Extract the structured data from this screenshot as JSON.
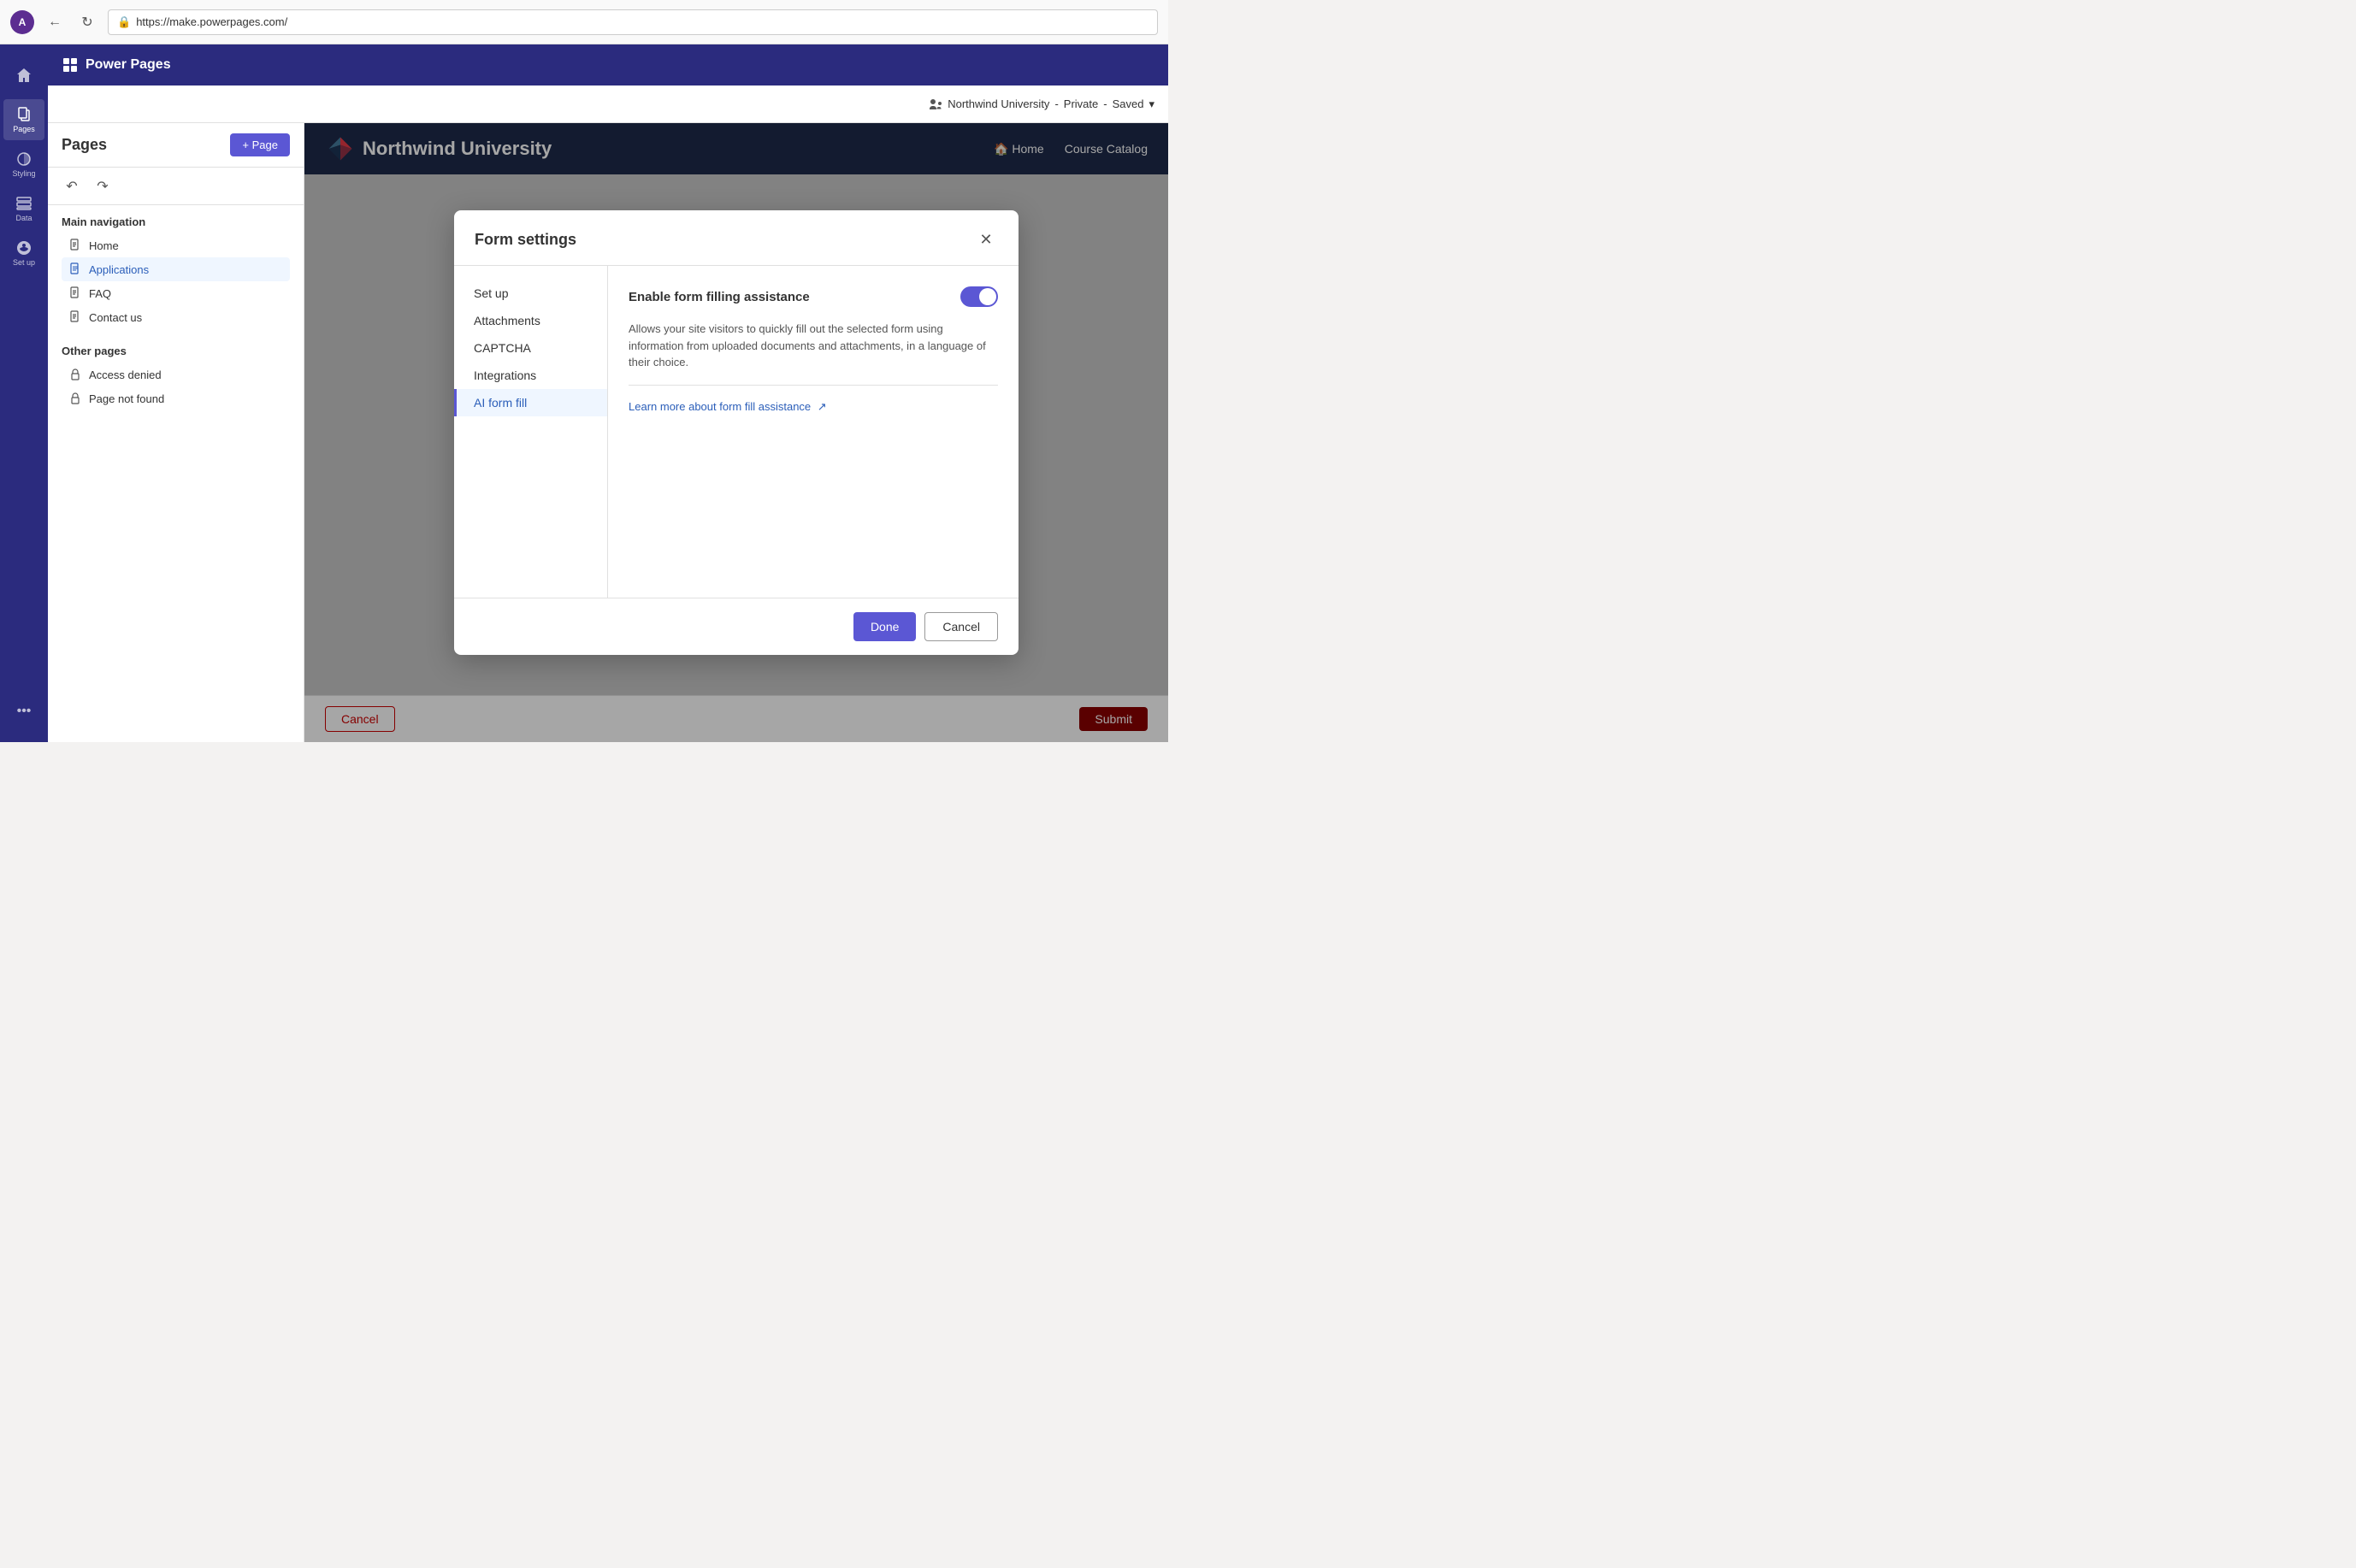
{
  "browser": {
    "url": "https://make.powerpages.com/",
    "back_title": "Back",
    "refresh_title": "Refresh"
  },
  "app": {
    "title": "Power Pages"
  },
  "site_info": {
    "name": "Northwind University",
    "visibility": "Private",
    "status": "Saved",
    "chevron": "▾",
    "users_icon": "👥"
  },
  "icon_nav": {
    "items": [
      {
        "id": "home",
        "label": "",
        "icon": "home"
      },
      {
        "id": "pages",
        "label": "Pages",
        "icon": "pages",
        "active": true
      },
      {
        "id": "styling",
        "label": "Styling",
        "icon": "styling"
      },
      {
        "id": "data",
        "label": "Data",
        "icon": "data"
      },
      {
        "id": "setup",
        "label": "Set up",
        "icon": "setup"
      }
    ],
    "more_label": "..."
  },
  "sidebar": {
    "title": "Pages",
    "add_button_label": "+ Page",
    "main_nav_title": "Main navigation",
    "pages": [
      {
        "id": "home",
        "label": "Home",
        "active": false
      },
      {
        "id": "applications",
        "label": "Applications",
        "active": true
      },
      {
        "id": "faq",
        "label": "FAQ",
        "active": false
      },
      {
        "id": "contact",
        "label": "Contact us",
        "active": false
      }
    ],
    "other_pages_title": "Other pages",
    "other_pages": [
      {
        "id": "access-denied",
        "label": "Access denied"
      },
      {
        "id": "page-not-found",
        "label": "Page not found"
      }
    ]
  },
  "toolbar": {
    "undo_label": "Undo",
    "redo_label": "Redo"
  },
  "preview": {
    "header": {
      "logo_text": "Northwind University",
      "nav": [
        {
          "label": "🏠 Home"
        },
        {
          "label": "Course Catalog"
        }
      ]
    }
  },
  "modal": {
    "title": "Form settings",
    "close_label": "✕",
    "nav_items": [
      {
        "id": "setup",
        "label": "Set up",
        "active": false
      },
      {
        "id": "attachments",
        "label": "Attachments",
        "active": false
      },
      {
        "id": "captcha",
        "label": "CAPTCHA",
        "active": false
      },
      {
        "id": "integrations",
        "label": "Integrations",
        "active": false
      },
      {
        "id": "ai-form-fill",
        "label": "AI form fill",
        "active": true
      }
    ],
    "content": {
      "toggle_label": "Enable form filling assistance",
      "toggle_on": true,
      "description": "Allows your site visitors to quickly fill out the selected form using information from uploaded documents and attachments, in a language of their choice.",
      "link_text": "Learn more about form fill assistance",
      "link_icon": "↗"
    },
    "footer": {
      "done_label": "Done",
      "cancel_label": "Cancel"
    }
  },
  "form_footer": {
    "cancel_label": "Cancel",
    "submit_label": "Submit"
  }
}
